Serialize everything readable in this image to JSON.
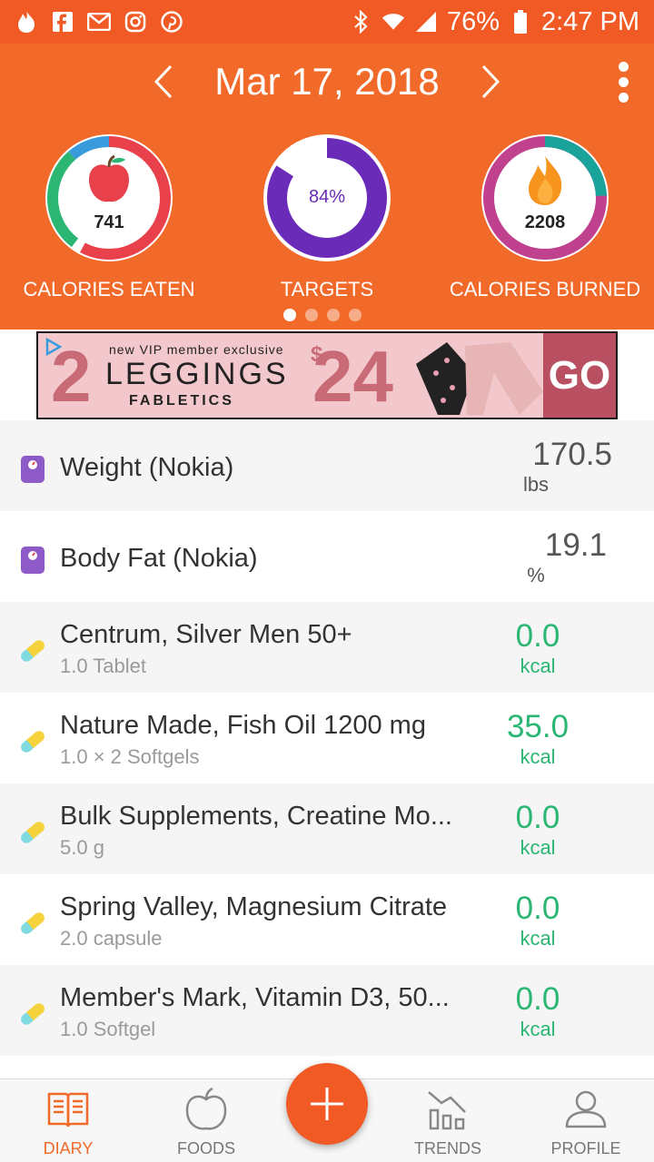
{
  "status_bar": {
    "battery": "76%",
    "time": "2:47 PM",
    "left_icons": [
      "flame-icon",
      "facebook-icon",
      "gmail-icon",
      "instagram-icon",
      "pinterest-icon"
    ],
    "right_icons": [
      "bluetooth-icon",
      "wifi-icon",
      "signal-icon",
      "battery-icon"
    ]
  },
  "header": {
    "date": "Mar 17, 2018"
  },
  "summary": {
    "calories_eaten": {
      "value": "741",
      "label": "CALORIES EATEN"
    },
    "targets": {
      "value": "84%",
      "label": "TARGETS",
      "fraction": 0.84
    },
    "calories_burned": {
      "value": "2208",
      "label": "CALORIES BURNED"
    },
    "page_dots": 4,
    "active_dot": 0
  },
  "ad": {
    "big_number": "2",
    "tagline": "new VIP member exclusive",
    "headline": "LEGGINGS",
    "brand": "FABLETICS",
    "price_symbol": "$",
    "price": "24",
    "cta": "GO"
  },
  "entries": [
    {
      "title": "Weight (Nokia)",
      "subtitle": "",
      "value": "170.5",
      "unit": "lbs",
      "kind": "scale"
    },
    {
      "title": "Body Fat (Nokia)",
      "subtitle": "",
      "value": "19.1",
      "unit": "%",
      "kind": "scale"
    },
    {
      "title": "Centrum, Silver Men 50+",
      "subtitle": "1.0 Tablet",
      "value": "0.0",
      "unit": "kcal",
      "kind": "pill"
    },
    {
      "title": "Nature Made, Fish Oil 1200 mg",
      "subtitle": "1.0 × 2 Softgels",
      "value": "35.0",
      "unit": "kcal",
      "kind": "pill"
    },
    {
      "title": "Bulk Supplements, Creatine Mo...",
      "subtitle": "5.0 g",
      "value": "0.0",
      "unit": "kcal",
      "kind": "pill"
    },
    {
      "title": "Spring Valley, Magnesium Citrate",
      "subtitle": "2.0 capsule",
      "value": "0.0",
      "unit": "kcal",
      "kind": "pill"
    },
    {
      "title": "Member's Mark, Vitamin D3, 50...",
      "subtitle": "1.0 Softgel",
      "value": "0.0",
      "unit": "kcal",
      "kind": "pill"
    }
  ],
  "bottom_nav": {
    "diary": "DIARY",
    "foods": "FOODS",
    "trends": "TRENDS",
    "profile": "PROFILE"
  },
  "colors": {
    "status_bar": "#f15a24",
    "header": "#f26a2a",
    "accent_green": "#2bb673",
    "targets_purple": "#6a2bb8",
    "burned_magenta": "#c0428f",
    "burned_teal": "#1aa39a"
  }
}
